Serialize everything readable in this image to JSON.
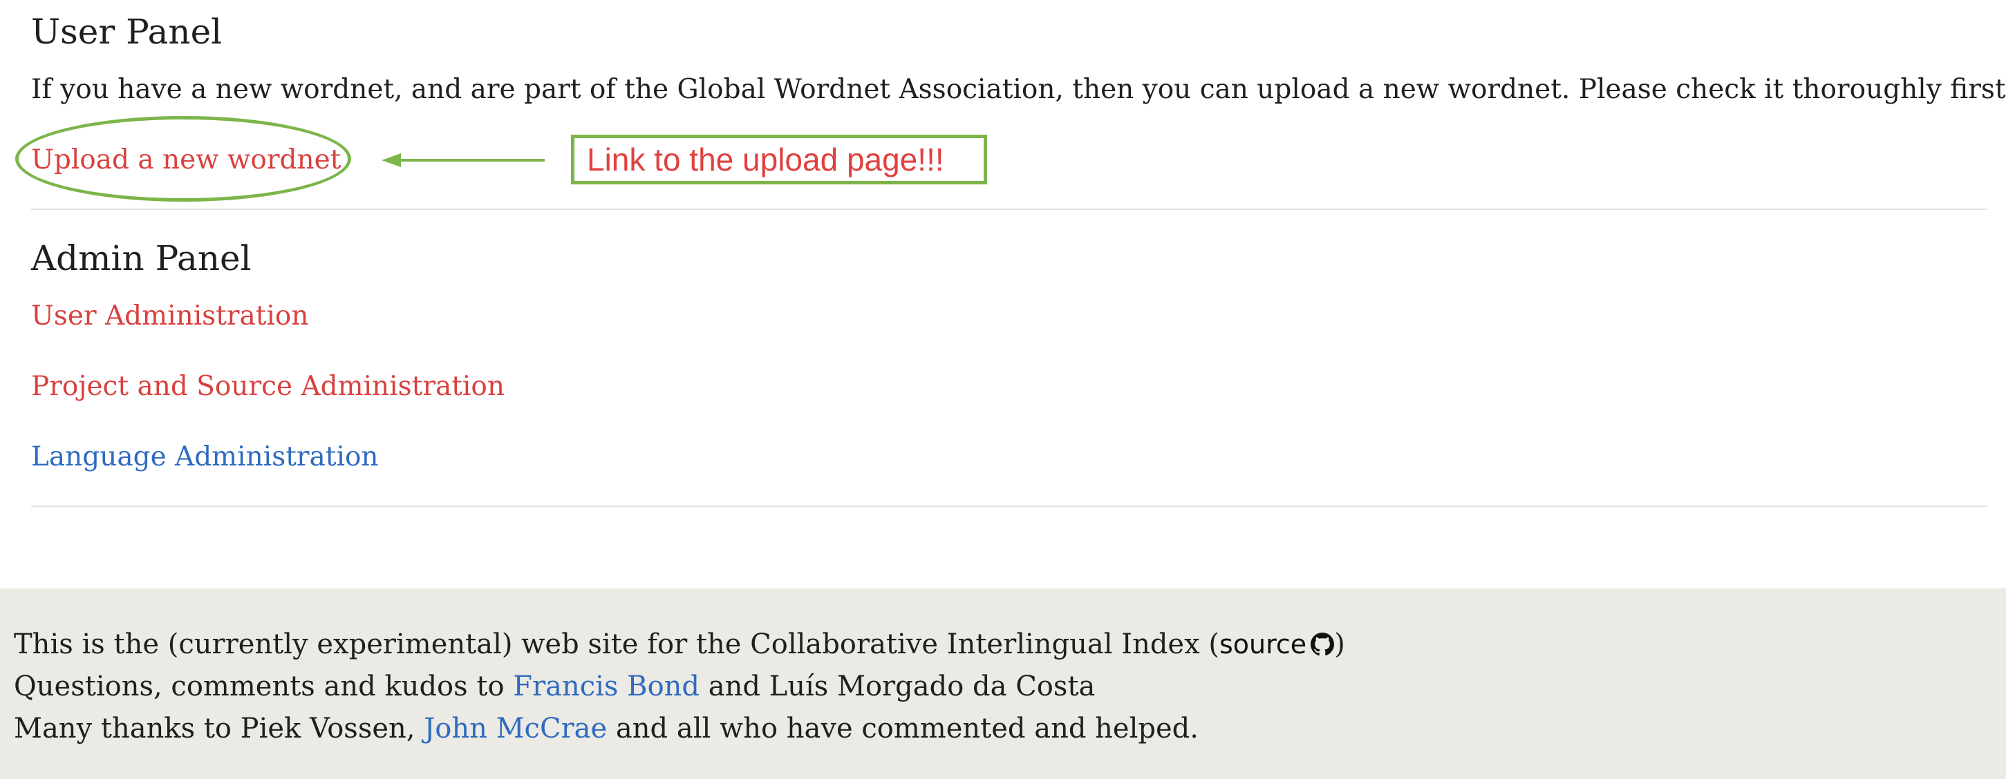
{
  "user_panel": {
    "title": "User Panel",
    "description": "If you have a new wordnet, and are part of the Global Wordnet Association, then you can upload a new wordnet. Please check it thoroughly first.",
    "upload_link": "Upload a new wordnet"
  },
  "annotation": {
    "label": "Link to the upload page!!!",
    "color": "#7cb54a",
    "text_color": "#e0403e"
  },
  "admin_panel": {
    "title": "Admin Panel",
    "links": [
      {
        "label": "User Administration",
        "color": "#d8413f"
      },
      {
        "label": "Project and Source Administration",
        "color": "#d8413f"
      },
      {
        "label": "Language Administration",
        "color": "#2f6bbf"
      }
    ]
  },
  "footer": {
    "line1_prefix": "This is the (currently experimental) web site for the Collaborative Interlingual Index (",
    "line1_source": "source",
    "line1_suffix": ")",
    "line2_prefix": "Questions, comments and kudos to ",
    "line2_link": "Francis Bond",
    "line2_suffix": " and Luís Morgado da Costa",
    "line3_prefix": "Many thanks to Piek Vossen, ",
    "line3_link": "John McCrae",
    "line3_suffix": " and all who have commented and helped.",
    "icon": "github-icon",
    "background": "#ebeae5"
  }
}
